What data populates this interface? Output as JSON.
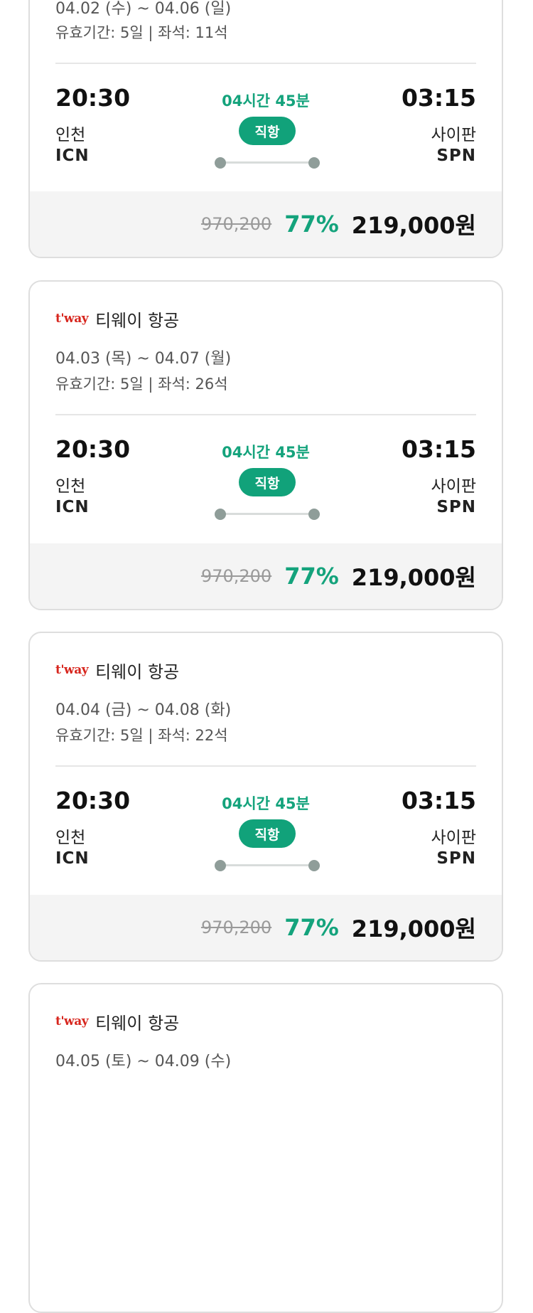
{
  "flights": [
    {
      "airline": "",
      "dates": "04.02 (수) ~ 04.06 (일)",
      "validity": "유효기간: 5일 | 좌석: 11석",
      "dep_time": "20:30",
      "dep_city": "인천",
      "dep_code": "ICN",
      "duration": "04시간 45분",
      "type": "직항",
      "arr_time": "03:15",
      "arr_city": "사이판",
      "arr_code": "SPN",
      "original_price": "970,200",
      "discount": "77%",
      "price": "219,000원"
    },
    {
      "logo": "t'way",
      "airline": "티웨이 항공",
      "dates": "04.03 (목) ~ 04.07 (월)",
      "validity": "유효기간: 5일 | 좌석: 26석",
      "dep_time": "20:30",
      "dep_city": "인천",
      "dep_code": "ICN",
      "duration": "04시간 45분",
      "type": "직항",
      "arr_time": "03:15",
      "arr_city": "사이판",
      "arr_code": "SPN",
      "original_price": "970,200",
      "discount": "77%",
      "price": "219,000원"
    },
    {
      "logo": "t'way",
      "airline": "티웨이 항공",
      "dates": "04.04 (금) ~ 04.08 (화)",
      "validity": "유효기간: 5일 | 좌석: 22석",
      "dep_time": "20:30",
      "dep_city": "인천",
      "dep_code": "ICN",
      "duration": "04시간 45분",
      "type": "직항",
      "arr_time": "03:15",
      "arr_city": "사이판",
      "arr_code": "SPN",
      "original_price": "970,200",
      "discount": "77%",
      "price": "219,000원"
    },
    {
      "logo": "t'way",
      "airline": "티웨이 항공",
      "dates": "04.05 (토) ~ 04.09 (수)"
    }
  ],
  "colors": {
    "accent": "#11a27a",
    "logo": "#d7261e",
    "dot": "#8f9d99"
  }
}
